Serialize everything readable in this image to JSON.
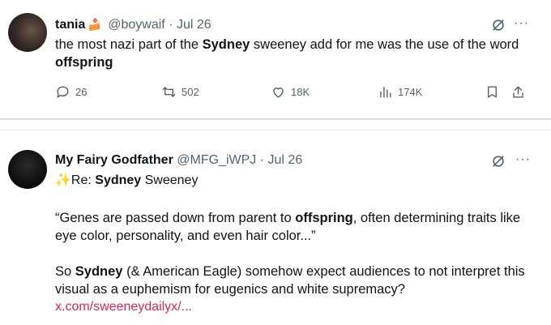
{
  "tweet1": {
    "name": "tania",
    "emoji": "🍰",
    "handle": "@boywaif",
    "separator": "·",
    "date": "Jul 26",
    "more": "···",
    "text_parts": [
      "the most nazi part of the ",
      "Sydney",
      " sweeney add for me was the use of the word ",
      "offspring"
    ],
    "actions": {
      "replies": "26",
      "reposts": "502",
      "likes": "18K",
      "views": "174K"
    }
  },
  "tweet2": {
    "name": "My Fairy Godfather",
    "handle": "@MFG_iWPJ",
    "separator": "·",
    "date": "Jul 26",
    "more": "···",
    "sparkle": "✨",
    "reply_prefix": "Re: ",
    "reply_bold": "Sydney",
    "reply_rest": " Sweeney",
    "quote_parts": [
      "“Genes are passed down from parent to ",
      "offspring",
      ", often determining traits like eye color, personality, and even hair color...”"
    ],
    "para2_parts": [
      "So ",
      "Sydney",
      " (& American Eagle) somehow expect audiences to not interpret this visual as a euphemism for eugenics and white supremacy?"
    ],
    "link": "x.com/sweeneydailyx/..."
  },
  "colors": {
    "link": "#e0245e",
    "muted": "#536471",
    "text": "#0f1419"
  }
}
